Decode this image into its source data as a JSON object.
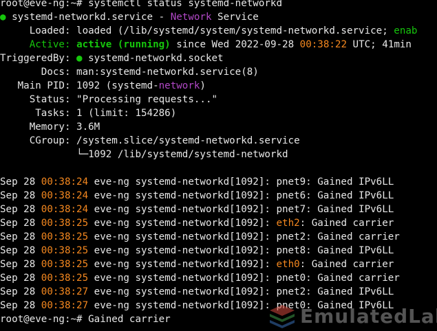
{
  "lines": [
    [
      {
        "t": "root@eve-ng:~# systemctl status systemd-networkd",
        "c": "c-default"
      }
    ],
    [
      {
        "t": "● ",
        "c": "c-green"
      },
      {
        "t": "systemd-networkd.service - ",
        "c": "c-default"
      },
      {
        "t": "Network",
        "c": "c-magenta"
      },
      {
        "t": " Service",
        "c": "c-default"
      }
    ],
    [
      {
        "t": "     Loaded: loaded (/lib/systemd/system/systemd-networkd.service; ",
        "c": "c-default"
      },
      {
        "t": "enab",
        "c": "c-green"
      }
    ],
    [
      {
        "t": "     ",
        "c": "c-default"
      },
      {
        "t": "Active: ",
        "c": "c-green"
      },
      {
        "t": "active (running)",
        "c": "c-green-b"
      },
      {
        "t": " since Wed 2022-09-28 ",
        "c": "c-default"
      },
      {
        "t": "00:38:22",
        "c": "c-orange"
      },
      {
        "t": " UTC; 41min",
        "c": "c-default"
      }
    ],
    [
      {
        "t": "TriggeredBy: ",
        "c": "c-default"
      },
      {
        "t": "●",
        "c": "c-green"
      },
      {
        "t": " systemd-networkd.socket",
        "c": "c-default"
      }
    ],
    [
      {
        "t": "       Docs: man:systemd-networkd.service(8)",
        "c": "c-default"
      }
    ],
    [
      {
        "t": "   Main PID: 1092 (systemd-",
        "c": "c-default"
      },
      {
        "t": "network",
        "c": "c-magenta"
      },
      {
        "t": ")",
        "c": "c-default"
      }
    ],
    [
      {
        "t": "     Status: \"Processing requests...\"",
        "c": "c-default"
      }
    ],
    [
      {
        "t": "      Tasks: 1 (limit: 154286)",
        "c": "c-default"
      }
    ],
    [
      {
        "t": "     Memory: 3.6M",
        "c": "c-default"
      }
    ],
    [
      {
        "t": "     CGroup: /system.slice/systemd-networkd.service",
        "c": "c-default"
      }
    ],
    [
      {
        "t": "             └─1092 /lib/systemd/systemd-networkd",
        "c": "c-default"
      }
    ],
    [
      {
        "t": "",
        "c": "c-default"
      }
    ],
    [
      {
        "t": "Sep 28 ",
        "c": "c-default"
      },
      {
        "t": "00:38:24",
        "c": "c-orange"
      },
      {
        "t": " eve-ng systemd-networkd[1092]: pnet9: Gained IPv6LL",
        "c": "c-default"
      }
    ],
    [
      {
        "t": "Sep 28 ",
        "c": "c-default"
      },
      {
        "t": "00:38:24",
        "c": "c-orange"
      },
      {
        "t": " eve-ng systemd-networkd[1092]: pnet6: Gained IPv6LL",
        "c": "c-default"
      }
    ],
    [
      {
        "t": "Sep 28 ",
        "c": "c-default"
      },
      {
        "t": "00:38:24",
        "c": "c-orange"
      },
      {
        "t": " eve-ng systemd-networkd[1092]: pnet7: Gained IPv6LL",
        "c": "c-default"
      }
    ],
    [
      {
        "t": "Sep 28 ",
        "c": "c-default"
      },
      {
        "t": "00:38:25",
        "c": "c-orange"
      },
      {
        "t": " eve-ng systemd-networkd[1092]: ",
        "c": "c-default"
      },
      {
        "t": "eth2",
        "c": "c-orange"
      },
      {
        "t": ": Gained carrier",
        "c": "c-default"
      }
    ],
    [
      {
        "t": "Sep 28 ",
        "c": "c-default"
      },
      {
        "t": "00:38:25",
        "c": "c-orange"
      },
      {
        "t": " eve-ng systemd-networkd[1092]: pnet2: Gained carrier",
        "c": "c-default"
      }
    ],
    [
      {
        "t": "Sep 28 ",
        "c": "c-default"
      },
      {
        "t": "00:38:25",
        "c": "c-orange"
      },
      {
        "t": " eve-ng systemd-networkd[1092]: pnet8: Gained IPv6LL",
        "c": "c-default"
      }
    ],
    [
      {
        "t": "Sep 28 ",
        "c": "c-default"
      },
      {
        "t": "00:38:25",
        "c": "c-orange"
      },
      {
        "t": " eve-ng systemd-networkd[1092]: ",
        "c": "c-default"
      },
      {
        "t": "eth0",
        "c": "c-orange"
      },
      {
        "t": ": Gained carrier",
        "c": "c-default"
      }
    ],
    [
      {
        "t": "Sep 28 ",
        "c": "c-default"
      },
      {
        "t": "00:38:25",
        "c": "c-orange"
      },
      {
        "t": " eve-ng systemd-networkd[1092]: pnet0: Gained carrier",
        "c": "c-default"
      }
    ],
    [
      {
        "t": "Sep 28 ",
        "c": "c-default"
      },
      {
        "t": "00:38:27",
        "c": "c-orange"
      },
      {
        "t": " eve-ng systemd-networkd[1092]: pnet2: Gained IPv6LL",
        "c": "c-default"
      }
    ],
    [
      {
        "t": "Sep 28 ",
        "c": "c-default"
      },
      {
        "t": "00:38:27",
        "c": "c-orange"
      },
      {
        "t": " eve-ng systemd-networkd[1092]: pnet0: Gained IPv6LL",
        "c": "c-default"
      }
    ],
    [
      {
        "t": "root@eve-ng:~# Gained carrier",
        "c": "c-default"
      }
    ]
  ],
  "watermark": {
    "text": "EmulatedLab",
    "icon": "stacked-layers-logo-icon"
  },
  "colors": {
    "background": "#000000",
    "text": "#e8e8e8",
    "green": "#16c60c",
    "magenta": "#b148c6",
    "orange": "#f5881f"
  }
}
